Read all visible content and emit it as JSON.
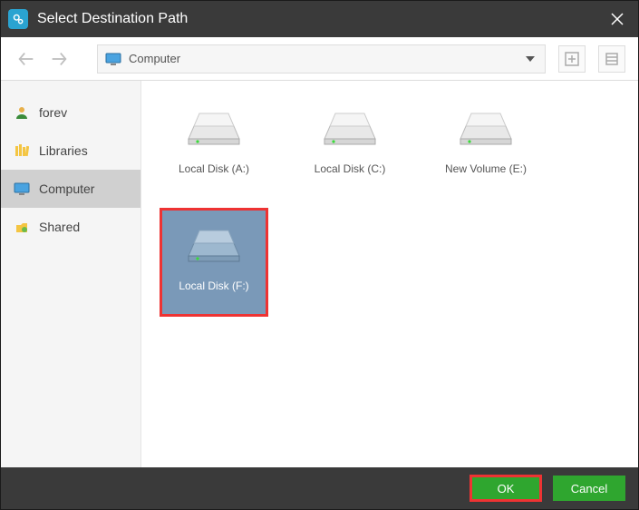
{
  "window": {
    "title": "Select Destination Path"
  },
  "path": {
    "label": "Computer"
  },
  "sidebar": {
    "items": [
      {
        "label": "forev"
      },
      {
        "label": "Libraries"
      },
      {
        "label": "Computer"
      },
      {
        "label": "Shared"
      }
    ]
  },
  "drives": [
    {
      "label": "Local Disk (A:)"
    },
    {
      "label": "Local Disk (C:)"
    },
    {
      "label": "New Volume (E:)"
    },
    {
      "label": "Local Disk (F:)"
    }
  ],
  "footer": {
    "ok": "OK",
    "cancel": "Cancel"
  }
}
